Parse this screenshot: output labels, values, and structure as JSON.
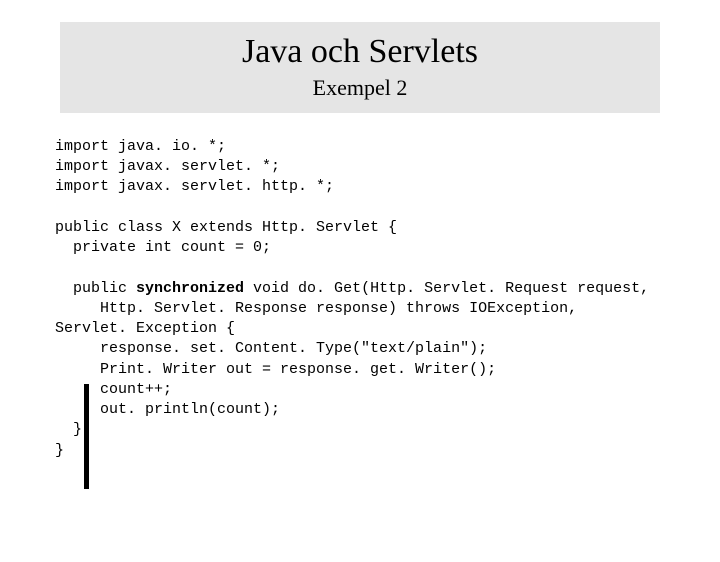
{
  "header": {
    "title": "Java och Servlets",
    "subtitle": "Exempel 2"
  },
  "code": {
    "l1": "import java. io. *;",
    "l2": "import javax. servlet. *;",
    "l3": "import javax. servlet. http. *;",
    "blank1": "",
    "l4": "public class X extends Http. Servlet {",
    "l5": "  private int count = 0;",
    "blank2": "",
    "l6a": "  public ",
    "l6b": "synchronized",
    "l6c": " void do. Get(Http. Servlet. Request request,",
    "l7": "     Http. Servlet. Response response) throws IOException,",
    "l8": "Servlet. Exception {",
    "l9": "     response. set. Content. Type(\"text/plain\");",
    "l10": "     Print. Writer out = response. get. Writer();",
    "l11": "     count++;",
    "l12": "     out. println(count);",
    "l13": "  }",
    "l14": "}"
  }
}
